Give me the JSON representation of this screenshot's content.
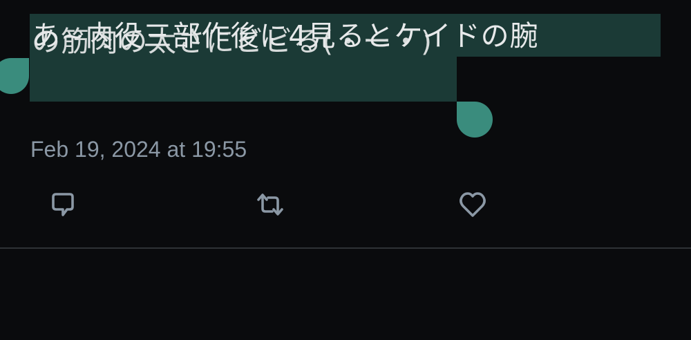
{
  "tweet": {
    "text_line1": "あ~内役三部作後に4見るとケイドの腕",
    "text_line2": "の筋肉の太さにビビる(・ー・)",
    "timestamp": "Feb 19, 2024 at 19:55"
  },
  "actions": {
    "reply_icon": "reply-icon",
    "retweet_icon": "retweet-icon",
    "like_icon": "heart-icon"
  },
  "colors": {
    "background": "#0a0b0d",
    "selection": "#1b3a36",
    "selection_handle": "#3a8c7d",
    "muted_text": "#8b98a5",
    "icon": "#8b98a5"
  }
}
